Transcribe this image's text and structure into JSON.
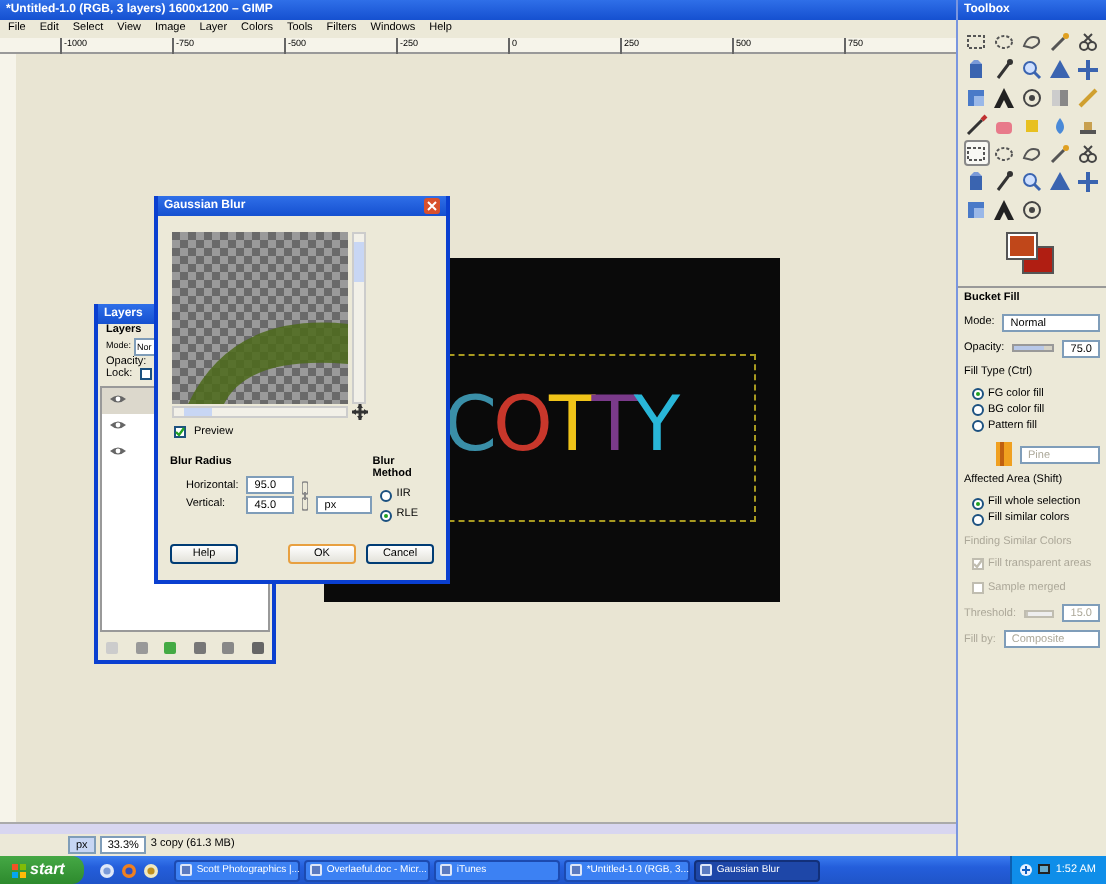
{
  "window": {
    "title": "*Untitled-1.0 (RGB, 3 layers) 1600x1200 – GIMP"
  },
  "menu": [
    "File",
    "Edit",
    "Select",
    "View",
    "Image",
    "Layer",
    "Colors",
    "Tools",
    "Filters",
    "Windows",
    "Help"
  ],
  "ruler": {
    "ticks": [
      "-1000",
      "-750",
      "-500",
      "-250",
      "0",
      "250",
      "500",
      "750"
    ]
  },
  "image": {
    "letters": [
      {
        "char": "C",
        "color": "#3a8fa8"
      },
      {
        "char": "O",
        "color": "#c8372b"
      },
      {
        "char": "T",
        "color": "#f0c419"
      },
      {
        "char": "T",
        "color": "#7a3a8a"
      },
      {
        "char": "Y",
        "color": "#29b6d8"
      }
    ]
  },
  "layers_dialog": {
    "title": "Layers",
    "heading": "Layers",
    "mode_label": "Mode:",
    "mode_value": "Nor",
    "opacity_label": "Opacity:",
    "lock_label": "Lock:",
    "lock_checked": false,
    "layers": [
      {
        "visible": true,
        "selected": true
      },
      {
        "visible": true,
        "selected": false
      },
      {
        "visible": true,
        "selected": false
      }
    ]
  },
  "blur_dialog": {
    "title": "Gaussian Blur",
    "preview_label": "Preview",
    "preview_checked": true,
    "radius_heading": "Blur Radius",
    "horizontal_label": "Horizontal:",
    "horizontal_value": "95.0",
    "vertical_label": "Vertical:",
    "vertical_value": "45.0",
    "unit": "px",
    "chain_linked": true,
    "method_heading": "Blur Method",
    "methods": [
      {
        "label": "IIR",
        "selected": false
      },
      {
        "label": "RLE",
        "selected": true
      }
    ],
    "buttons": [
      "Help",
      "OK",
      "Cancel"
    ]
  },
  "toolbox": {
    "title": "Toolbox",
    "tools": [
      {
        "selected": false
      },
      {
        "selected": false
      },
      {
        "selected": false
      },
      {
        "selected": false
      },
      {
        "selected": false
      },
      {
        "selected": false
      },
      {
        "selected": false
      },
      {
        "selected": false
      },
      {
        "selected": false
      },
      {
        "selected": false
      },
      {
        "selected": false
      },
      {
        "selected": false
      },
      {
        "selected": false
      },
      {
        "selected": false
      },
      {
        "selected": false
      },
      {
        "selected": false
      },
      {
        "selected": false
      },
      {
        "selected": false
      },
      {
        "selected": false
      },
      {
        "selected": false
      },
      {
        "selected": true
      },
      {
        "selected": false
      },
      {
        "selected": false
      },
      {
        "selected": false
      },
      {
        "selected": false
      },
      {
        "selected": false
      },
      {
        "selected": false
      },
      {
        "selected": false
      },
      {
        "selected": false
      },
      {
        "selected": false
      },
      {
        "selected": false
      },
      {
        "selected": false
      },
      {
        "selected": false
      }
    ]
  },
  "tool_options": {
    "title": "Bucket Fill",
    "mode_label": "Mode:",
    "mode_value": "Normal",
    "opacity_label": "Opacity:",
    "opacity_value": "75.0",
    "level": 0.75,
    "fill_type_heading": "Fill Type  (Ctrl)",
    "fill_types": [
      {
        "label": "FG color fill",
        "selected": true
      },
      {
        "label": "BG color fill",
        "selected": false
      },
      {
        "label": "Pattern fill",
        "selected": false
      }
    ],
    "pattern_name": "Pine",
    "area_heading": "Affected Area  (Shift)",
    "areas": [
      {
        "label": "Fill whole selection",
        "selected": true
      },
      {
        "label": "Fill similar colors",
        "selected": false
      }
    ],
    "similar_heading": "Finding Similar Colors",
    "similar_options": [
      {
        "label": "Fill transparent areas",
        "checked": true
      },
      {
        "label": "Sample merged",
        "checked": false
      }
    ],
    "threshold": {
      "label": "Threshold:",
      "value": "15.0",
      "level": 0.06
    },
    "fill_by_label": "Fill by:",
    "fill_by_value": "Composite"
  },
  "status": {
    "unit": "px",
    "zoom": "33.3%",
    "message": "3 copy (61.3 MB)"
  },
  "taskbar": {
    "start": "start",
    "tasks": [
      {
        "label": "Scott Photographics |...",
        "selected": false
      },
      {
        "label": "Overlaeful.doc - Micr...",
        "selected": false
      },
      {
        "label": "iTunes",
        "selected": false
      },
      {
        "label": "*Untitled-1.0 (RGB, 3...",
        "selected": false
      },
      {
        "label": "Gaussian Blur",
        "selected": true
      }
    ],
    "clock": "1:52 AM"
  }
}
